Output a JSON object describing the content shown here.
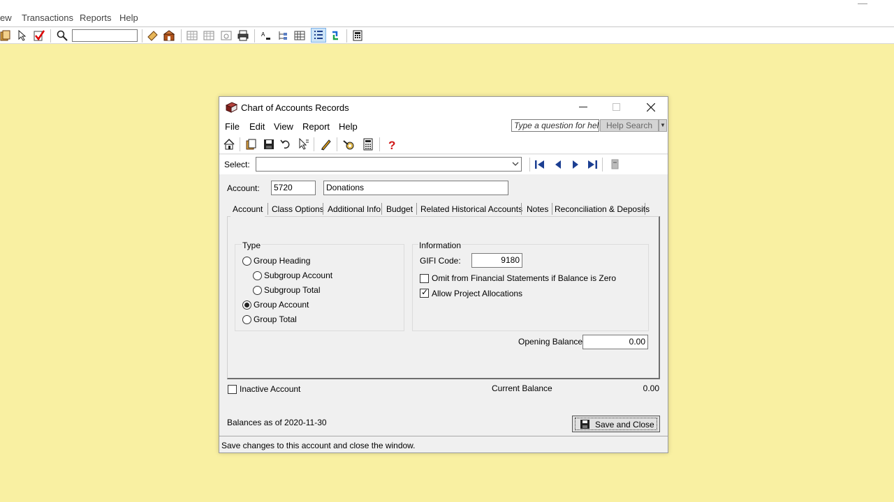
{
  "app": {
    "menus": [
      "ew",
      "Transactions",
      "Reports",
      "Help"
    ]
  },
  "dialog": {
    "title": "Chart of Accounts Records",
    "menus": [
      "File",
      "Edit",
      "View",
      "Report",
      "Help"
    ],
    "help_placeholder": "Type a question for help",
    "help_search_label": "Help Search",
    "select_label": "Select:",
    "select_value": "",
    "account_label": "Account:",
    "account_number": "5720",
    "account_name": "Donations",
    "tabs": [
      "Account",
      "Class Options",
      "Additional Info",
      "Budget",
      "Related Historical Accounts",
      "Notes",
      "Reconciliation & Deposits"
    ],
    "type": {
      "label": "Type",
      "options": [
        "Group Heading",
        "Subgroup Account",
        "Subgroup Total",
        "Group Account",
        "Group Total"
      ],
      "selected": "Group Account"
    },
    "information": {
      "label": "Information",
      "gifi_label": "GIFI Code:",
      "gifi_code": "9180",
      "omit_label": "Omit from Financial Statements if Balance is Zero",
      "omit_checked": false,
      "allow_label": "Allow Project Allocations",
      "allow_checked": true
    },
    "opening_balance_label": "Opening Balance",
    "opening_balance": "0.00",
    "inactive_label": "Inactive Account",
    "inactive_checked": false,
    "current_balance_label": "Current Balance",
    "current_balance": "0.00",
    "balances_as_of": "Balances as of 2020-11-30",
    "save_close_label": "Save and Close",
    "status_text": "Save changes to this account and close the window."
  }
}
